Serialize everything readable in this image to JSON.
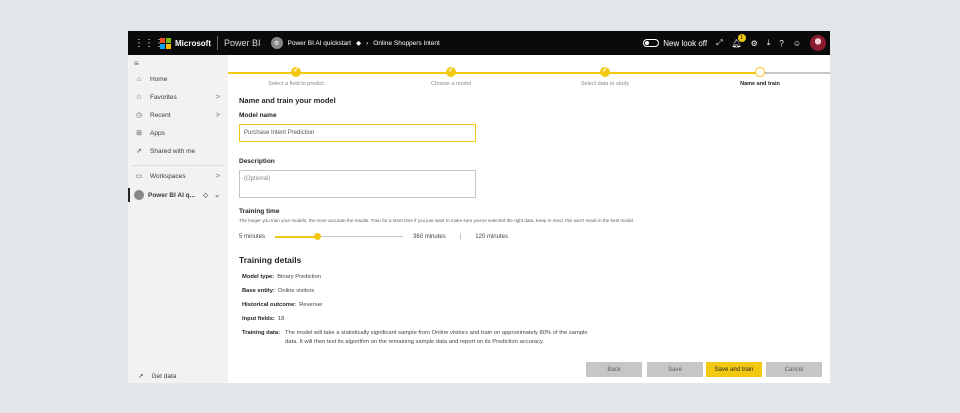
{
  "topbar": {
    "waffle_glyph": "⋮⋮⋮",
    "brand": "Microsoft",
    "product": "Power BI",
    "workspace": "Power BI AI quickstart",
    "page": "Online Shoppers Intent",
    "new_look_label": "New look off",
    "notification_count": "1"
  },
  "sidebar": {
    "items": [
      {
        "label": "Home",
        "icon": "home-icon"
      },
      {
        "label": "Favorites",
        "icon": "star-icon",
        "chevron": ">"
      },
      {
        "label": "Recent",
        "icon": "clock-icon",
        "chevron": ">"
      },
      {
        "label": "Apps",
        "icon": "apps-icon"
      },
      {
        "label": "Shared with me",
        "icon": "share-icon"
      },
      {
        "label": "Workspaces",
        "icon": "workspaces-icon",
        "chevron": ">"
      },
      {
        "label": "Power BI AI q...",
        "icon": "workspace-avatar",
        "chevron": "⌄"
      }
    ],
    "get_data": "Get data"
  },
  "stepper": {
    "steps": [
      {
        "label": "Select a field to predict",
        "state": "done"
      },
      {
        "label": "Choose a model",
        "state": "done"
      },
      {
        "label": "Select data to study",
        "state": "done"
      },
      {
        "label": "Name and train",
        "state": "current"
      }
    ]
  },
  "form": {
    "heading": "Name and train your model",
    "model_name_label": "Model name",
    "model_name_value": "Purchase Intent Prediction",
    "description_label": "Description",
    "description_placeholder": "(Optional)",
    "training_time_label": "Training time",
    "training_time_hint": "The longer you train your models, the more accurate the results. Train for a short time if you just want to make sure you've selected the right data. Keep in mind, this won't result in the best model.",
    "slider_min": "5 minutes",
    "slider_max": "360 minutes",
    "slider_value": "120 minutes",
    "slider_fraction": 0.33
  },
  "details": {
    "heading": "Training details",
    "model_type_label": "Model type:",
    "model_type": "Binary Prediction",
    "base_entity_label": "Base entity:",
    "base_entity": "Online visitors",
    "historical_outcome_label": "Historical outcome:",
    "historical_outcome": "Revenue",
    "input_fields_label": "Input fields:",
    "input_fields": "18",
    "training_data_label": "Training data:",
    "training_data": "The model will take a statistically significant sample from Online visitors and train on approximately 80% of the sample data. It will then test its algorithm on the remaining sample data and report on its Prediction accuracy."
  },
  "buttons": {
    "back": "Back",
    "save": "Save",
    "save_and_train": "Save and train",
    "cancel": "Cancel"
  },
  "colors": {
    "accent": "#f2c811",
    "topbar": "#0a0a0a"
  }
}
